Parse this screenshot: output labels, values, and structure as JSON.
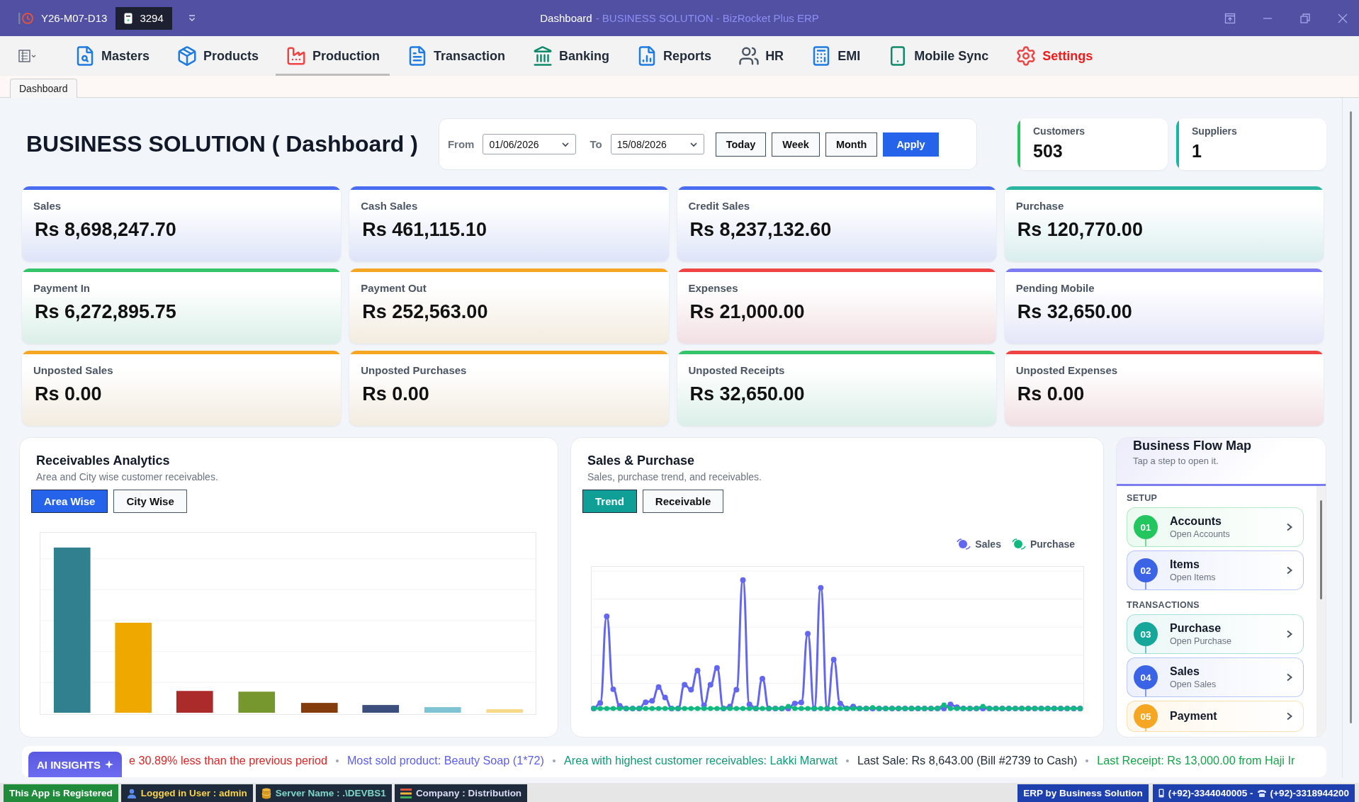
{
  "title_bar": {
    "date_code": "Y26-M07-D13",
    "counter": "3294",
    "title": "Dashboard",
    "subtitle": "- BUSINESS SOLUTION - BizRocket Plus ERP"
  },
  "menu": [
    {
      "label": "Masters",
      "kind": "masters",
      "selected": false,
      "highlighted": false
    },
    {
      "label": "Products",
      "kind": "products",
      "selected": false,
      "highlighted": false
    },
    {
      "label": "Production",
      "kind": "production",
      "selected": true,
      "highlighted": false
    },
    {
      "label": "Transaction",
      "kind": "transaction",
      "selected": false,
      "highlighted": false
    },
    {
      "label": "Banking",
      "kind": "banking",
      "selected": false,
      "highlighted": false
    },
    {
      "label": "Reports",
      "kind": "reports",
      "selected": false,
      "highlighted": false
    },
    {
      "label": "HR",
      "kind": "hr",
      "selected": false,
      "highlighted": false
    },
    {
      "label": "EMI",
      "kind": "emi",
      "selected": false,
      "highlighted": false
    },
    {
      "label": "Mobile Sync",
      "kind": "mobile",
      "selected": false,
      "highlighted": false
    },
    {
      "label": "Settings",
      "kind": "settings",
      "selected": false,
      "highlighted": true
    }
  ],
  "tabs": [
    {
      "label": "Dashboard",
      "selected": true
    }
  ],
  "page_title": "BUSINESS SOLUTION ( Dashboard )",
  "date_filter": {
    "from_label": "From",
    "from_date": "01/06/2026",
    "to_label": "To",
    "to_date": "15/08/2026",
    "buttons": [
      {
        "label": "Today",
        "kind": "outline"
      },
      {
        "label": "Week",
        "kind": "outline"
      },
      {
        "label": "Month",
        "kind": "outline"
      },
      {
        "label": "Apply",
        "kind": "primary"
      }
    ]
  },
  "counters": [
    {
      "label": "Customers",
      "value": "503",
      "color": "#22c55e"
    },
    {
      "label": "Suppliers",
      "value": "1",
      "color": "#14b8a6"
    }
  ],
  "kpi_cards": [
    {
      "label": "Sales",
      "value": "Rs 8,698,247.70",
      "color": "#4a6cf0"
    },
    {
      "label": "Cash Sales",
      "value": "Rs 461,115.10",
      "color": "#4a6cf0"
    },
    {
      "label": "Credit Sales",
      "value": "Rs 8,237,132.60",
      "color": "#4a6cf0"
    },
    {
      "label": "Purchase",
      "value": "Rs 120,770.00",
      "color": "#2ab5a0"
    },
    {
      "label": "Payment In",
      "value": "Rs 6,272,895.75",
      "color": "#34c46a"
    },
    {
      "label": "Payment Out",
      "value": "Rs 252,563.00",
      "color": "#f5a623"
    },
    {
      "label": "Expenses",
      "value": "Rs 21,000.00",
      "color": "#ef4444"
    },
    {
      "label": "Pending Mobile",
      "value": "Rs 32,650.00",
      "color": "#7c7cf0"
    },
    {
      "label": "Unposted Sales",
      "value": "Rs 0.00",
      "color": "#f5a623"
    },
    {
      "label": "Unposted Purchases",
      "value": "Rs 0.00",
      "color": "#f5a623"
    },
    {
      "label": "Unposted Receipts",
      "value": "Rs 32,650.00",
      "color": "#34c46a"
    },
    {
      "label": "Unposted Expenses",
      "value": "Rs 0.00",
      "color": "#ef4444"
    }
  ],
  "receivables": {
    "title": "Receivables Analytics",
    "subtitle": "Area and City wise customer receivables.",
    "toggles": [
      {
        "label": "Area Wise",
        "selected": true
      },
      {
        "label": "City Wise",
        "selected": false
      }
    ]
  },
  "sales_purchase": {
    "title": "Sales & Purchase",
    "subtitle": "Sales, purchase trend, and receivables.",
    "toggles": [
      {
        "label": "Trend",
        "selected": true
      },
      {
        "label": "Receivable",
        "selected": false
      }
    ],
    "legend": [
      {
        "label": "Sales",
        "color": "#6366f1"
      },
      {
        "label": "Purchase",
        "color": "#10b981"
      }
    ]
  },
  "flow_map": {
    "title": "Business Flow Map",
    "subtitle": "Tap a step to open it.",
    "sections": [
      {
        "label": "SETUP",
        "steps": [
          {
            "number": "01",
            "title": "Accounts",
            "subtitle": "Open Accounts",
            "color": "#22c55e"
          },
          {
            "number": "02",
            "title": "Items",
            "subtitle": "Open Items",
            "color": "#3b63e6"
          }
        ]
      },
      {
        "label": "TRANSACTIONS",
        "steps": [
          {
            "number": "03",
            "title": "Purchase",
            "subtitle": "Open Purchase",
            "color": "#14a79a"
          },
          {
            "number": "04",
            "title": "Sales",
            "subtitle": "Open Sales",
            "color": "#3b63e6"
          },
          {
            "number": "05",
            "title": "Payment",
            "color": "#f5a623"
          }
        ]
      }
    ]
  },
  "insights": {
    "badge": "AI INSIGHTS",
    "items": [
      {
        "text": "e 30.89% less than the previous period",
        "color": "#dc2626"
      },
      {
        "text": "Most sold product: Beauty Soap (1*72)",
        "color": "#5b5ef0"
      },
      {
        "text": "Area with highest customer receivables: Lakki Marwat",
        "color": "#0f9a78"
      },
      {
        "text": "Last Sale: Rs 8,643.00 (Bill #2739 to Cash)",
        "color": "#1f2937"
      },
      {
        "text": "Last Receipt: Rs 13,000.00 from Haji Ir",
        "color": "#16a34a"
      }
    ]
  },
  "status_bar": {
    "left": [
      {
        "kind": "registered",
        "label": "This App is Registered",
        "color": "#ffffff"
      },
      {
        "kind": "user",
        "label": "Logged in User : admin",
        "color": "#f8d24a"
      },
      {
        "kind": "server",
        "label": "Server Name : .\\DEVBS1",
        "color": "#7fd6c6"
      },
      {
        "kind": "company",
        "label": "Company : Distribution",
        "color": "#dcdcf7"
      }
    ],
    "right": [
      {
        "kind": "brand",
        "label": "ERP by Business Solution",
        "color": "#ffffff"
      },
      {
        "kind": "contact",
        "phones": [
          "(+92)-3344040005 -",
          "(+92)-3318944200"
        ],
        "color": "#ffffff"
      }
    ]
  }
}
